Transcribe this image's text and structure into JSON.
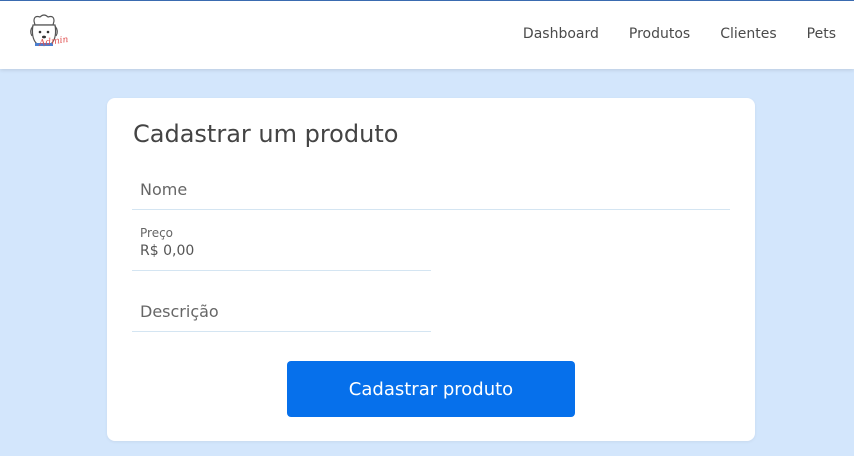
{
  "header": {
    "logo_text": "Admin",
    "nav": [
      {
        "label": "Dashboard"
      },
      {
        "label": "Produtos"
      },
      {
        "label": "Clientes"
      },
      {
        "label": "Pets"
      }
    ]
  },
  "form": {
    "title": "Cadastrar um produto",
    "nome": {
      "placeholder": "Nome",
      "value": ""
    },
    "preco": {
      "label": "Preço",
      "value": "R$ 0,00"
    },
    "descricao": {
      "placeholder": "Descrição",
      "value": ""
    },
    "submit_label": "Cadastrar produto"
  },
  "colors": {
    "background": "#d3e6fc",
    "primary": "#0670eb",
    "logo_accent": "#e05050"
  }
}
